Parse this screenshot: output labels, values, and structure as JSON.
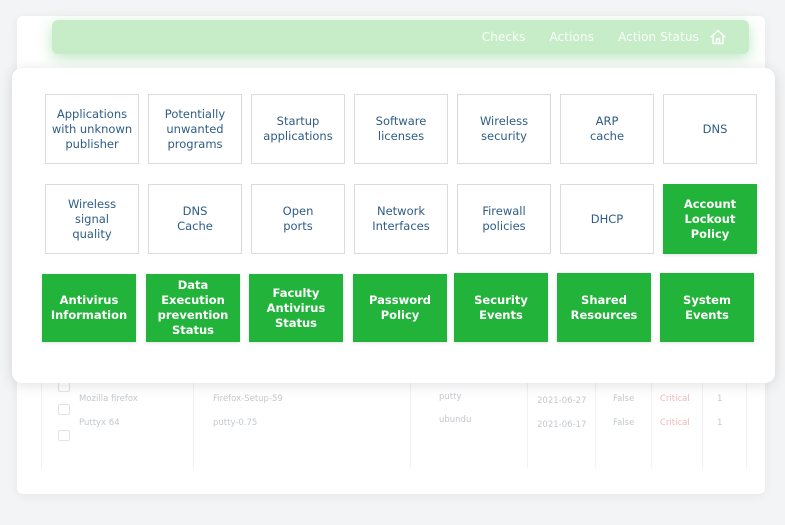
{
  "nav": {
    "items": [
      "Checks",
      "Actions",
      "Action Status"
    ],
    "home_icon": "home-icon"
  },
  "modal": {
    "row1": [
      "Applications with unknown publisher",
      "Potentially unwanted programs",
      "Startup applications",
      "Software licenses",
      "Wireless security",
      "ARP cache",
      "DNS"
    ],
    "row2": [
      "Wireless signal quality",
      "DNS Cache",
      "Open ports",
      "Network Interfaces",
      "Firewall policies",
      "DHCP",
      "Account Lockout Policy"
    ],
    "row3": [
      "Antivirus Information",
      "Data Execution prevention Status",
      "Faculty Antivirus Status",
      "Password Policy",
      "Security Events",
      "Shared Resources",
      "System Events"
    ]
  },
  "background_table": {
    "rows": [
      {
        "name": "Mozilla firefox",
        "file": "Firefox-Setup-59",
        "user": "putty",
        "date": "2021-06-27",
        "flag": "False",
        "severity": "Critical",
        "count": "1"
      },
      {
        "name": "Puttyx 64",
        "file": "putty-0.75",
        "user": "ubundu",
        "date": "2021-06-17",
        "flag": "False",
        "severity": "Critical",
        "count": "1"
      }
    ]
  },
  "colors": {
    "accent_green": "#22b33a",
    "topbar_green": "#c6ecc8",
    "tile_text_blue": "#2f5c86",
    "critical_red": "#e35a5a"
  }
}
